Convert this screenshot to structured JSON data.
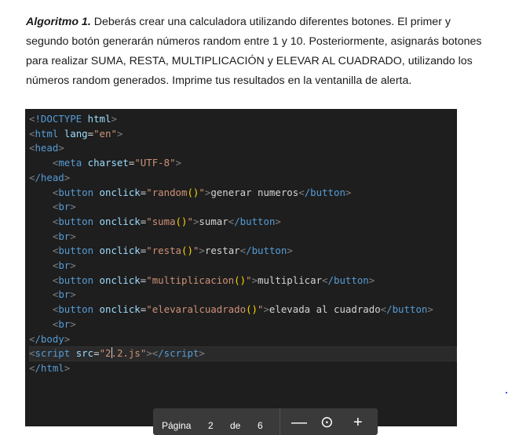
{
  "paragraph": {
    "heading": "Algoritmo 1.",
    "line1_rest": " Deberás crear una calculadora utilizando diferentes botones. El primer y",
    "line2": "segundo botón generarán números random entre 1 y 10. Posteriormente, asignarás botones",
    "line3": "para realizar SUMA, RESTA, MULTIPLICACIÓN y ELEVAR AL CUADRADO, utilizando los",
    "line4": "números random generados. Imprime tus resultados en la ventanilla de alerta."
  },
  "code": {
    "doctype_kw": "!DOCTYPE",
    "doctype_val": "html",
    "html_tag": "html",
    "lang_attr": "lang",
    "lang_val": "\"en\"",
    "head_tag": "head",
    "meta_tag": "meta",
    "charset_attr": "charset",
    "charset_val": "\"UTF-8\"",
    "head_close": "/head",
    "button_tag": "button",
    "button_close": "/button",
    "onclick_attr": "onclick",
    "br_tag": "br",
    "buttons": [
      {
        "fn": "random",
        "label": "generar numeros"
      },
      {
        "fn": "suma",
        "label": "sumar"
      },
      {
        "fn": "resta",
        "label": "restar"
      },
      {
        "fn": "multiplicacion",
        "label": "multiplicar"
      },
      {
        "fn": "elevaralcuadrado",
        "label": "elevada al cuadrado"
      }
    ],
    "body_close": "/body",
    "script_tag": "script",
    "src_attr": "src",
    "src_before_cursor": "2",
    "src_after_cursor": ".2.js",
    "script_close": "/script",
    "html_close": "/html"
  },
  "pager": {
    "page_label": "Página",
    "page_number": "2",
    "of_label": "de",
    "page_total": "6",
    "zoom_out": "—",
    "zoom_reset": "⊙",
    "zoom_in": "+"
  }
}
